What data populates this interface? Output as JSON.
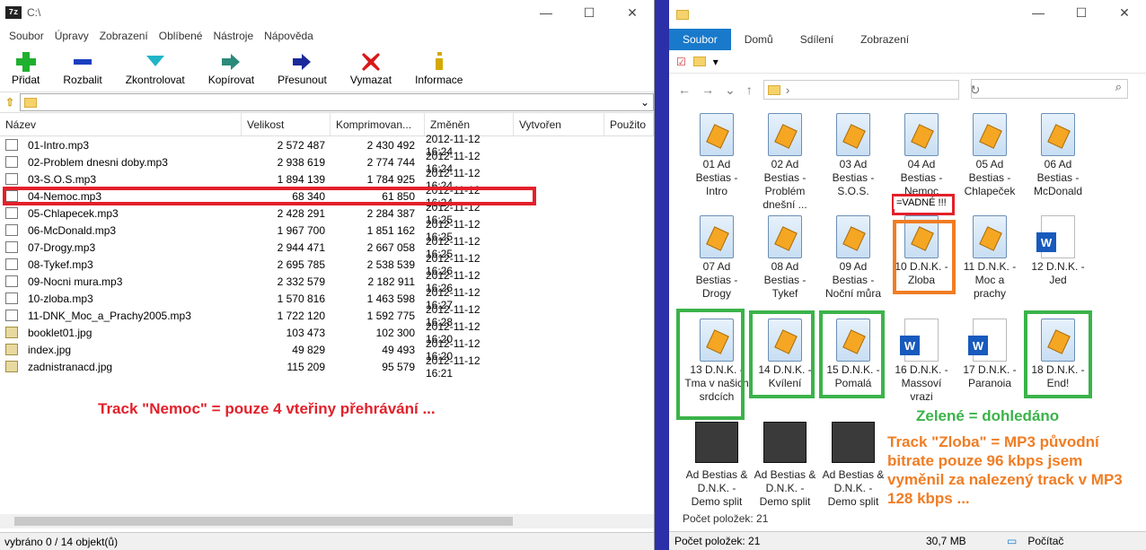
{
  "zip": {
    "title": "C:\\",
    "menu": [
      "Soubor",
      "Úpravy",
      "Zobrazení",
      "Oblíbené",
      "Nástroje",
      "Nápověda"
    ],
    "tools": [
      {
        "label": "Přidat",
        "icon": "add-icon",
        "color": "#1fb02f"
      },
      {
        "label": "Rozbalit",
        "icon": "extract-icon",
        "color": "#1a3fc0"
      },
      {
        "label": "Zkontrolovat",
        "icon": "test-icon",
        "color": "#20b5c8"
      },
      {
        "label": "Kopírovat",
        "icon": "copy-icon",
        "color": "#2b8a7a"
      },
      {
        "label": "Přesunout",
        "icon": "move-icon",
        "color": "#1a2a9a"
      },
      {
        "label": "Vymazat",
        "icon": "delete-icon",
        "color": "#d81818"
      },
      {
        "label": "Informace",
        "icon": "info-icon",
        "color": "#d4a800"
      }
    ],
    "columns": [
      "Název",
      "Velikost",
      "Komprimovan...",
      "Změněn",
      "Vytvořen",
      "Použito"
    ],
    "files": [
      [
        "01-Intro.mp3",
        "2 572 487",
        "2 430 492",
        "2012-11-12 16:24"
      ],
      [
        "02-Problem dnesni doby.mp3",
        "2 938 619",
        "2 774 744",
        "2012-11-12 16:24"
      ],
      [
        "03-S.O.S.mp3",
        "1 894 139",
        "1 784 925",
        "2012-11-12 16:24"
      ],
      [
        "04-Nemoc.mp3",
        "68 340",
        "61 850",
        "2012-11-12 16:24"
      ],
      [
        "05-Chlapecek.mp3",
        "2 428 291",
        "2 284 387",
        "2012-11-12 16:25"
      ],
      [
        "06-McDonald.mp3",
        "1 967 700",
        "1 851 162",
        "2012-11-12 16:25"
      ],
      [
        "07-Drogy.mp3",
        "2 944 471",
        "2 667 058",
        "2012-11-12 16:25"
      ],
      [
        "08-Tykef.mp3",
        "2 695 785",
        "2 538 539",
        "2012-11-12 16:26"
      ],
      [
        "09-Nocni mura.mp3",
        "2 332 579",
        "2 182 911",
        "2012-11-12 16:26"
      ],
      [
        "10-zloba.mp3",
        "1 570 816",
        "1 463 598",
        "2012-11-12 16:27"
      ],
      [
        "11-DNK_Moc_a_Prachy2005.mp3",
        "1 722 120",
        "1 592 775",
        "2012-11-12 16:28"
      ],
      [
        "booklet01.jpg",
        "103 473",
        "102 300",
        "2012-11-12 16:20"
      ],
      [
        "index.jpg",
        "49 829",
        "49 493",
        "2012-11-12 16:20"
      ],
      [
        "zadnistranacd.jpg",
        "115 209",
        "95 579",
        "2012-11-12 16:21"
      ]
    ],
    "note": "Track \"Nemoc\" = pouze 4  vteřiny přehrávání ...",
    "status": "vybráno 0 / 14 objekt(ů)"
  },
  "explorer": {
    "ribbon": [
      "Soubor",
      "Domů",
      "Sdílení",
      "Zobrazení"
    ],
    "items": [
      {
        "label": "01 Ad Bestias - Intro",
        "kind": "mp3"
      },
      {
        "label": "02 Ad Bestias - Problém dnešní ...",
        "kind": "mp3"
      },
      {
        "label": "03 Ad Bestias - S.O.S.",
        "kind": "mp3"
      },
      {
        "label": "04 Ad Bestias - Nemoc",
        "kind": "mp3"
      },
      {
        "label": "05 Ad Bestias - Chlapeček",
        "kind": "mp3"
      },
      {
        "label": "06 Ad Bestias - McDonald",
        "kind": "mp3"
      },
      {
        "label": "07 Ad Bestias - Drogy",
        "kind": "mp3"
      },
      {
        "label": "08 Ad Bestias - Tykef",
        "kind": "mp3"
      },
      {
        "label": "09 Ad Bestias - Noční můra",
        "kind": "mp3"
      },
      {
        "label": "10 D.N.K. - Zloba",
        "kind": "mp3"
      },
      {
        "label": "11 D.N.K. - Moc a prachy",
        "kind": "mp3"
      },
      {
        "label": "12 D.N.K. - Jed",
        "kind": "word"
      },
      {
        "label": "13 D.N.K. - Tma v našich srdcích",
        "kind": "mp3"
      },
      {
        "label": "14 D.N.K. - Kvílení",
        "kind": "mp3"
      },
      {
        "label": "15 D.N.K. - Pomalá",
        "kind": "mp3"
      },
      {
        "label": "16 D.N.K. - Massoví vrazi",
        "kind": "word"
      },
      {
        "label": "17 D.N.K. - Paranoia",
        "kind": "word"
      },
      {
        "label": "18 D.N.K. - End!",
        "kind": "mp3"
      },
      {
        "label": "Ad Bestias & D.N.K. - Demo split",
        "kind": "img"
      },
      {
        "label": "Ad Bestias & D.N.K. - Demo split",
        "kind": "img"
      },
      {
        "label": "Ad Bestias & D.N.K. - Demo split",
        "kind": "img"
      }
    ],
    "vadne": "=VADNÉ !!!",
    "note_green": "Zelené = dohledáno",
    "note_orange": "Track \"Zloba\" = MP3 původní bitrate pouze 96 kbps jsem vyměnil za nalezený track v MP3 128 kbps ...",
    "count_inner": "Počet položek: 21",
    "status": {
      "count": "Počet položek: 21",
      "size": "30,7 MB",
      "computer": "Počítač"
    }
  }
}
